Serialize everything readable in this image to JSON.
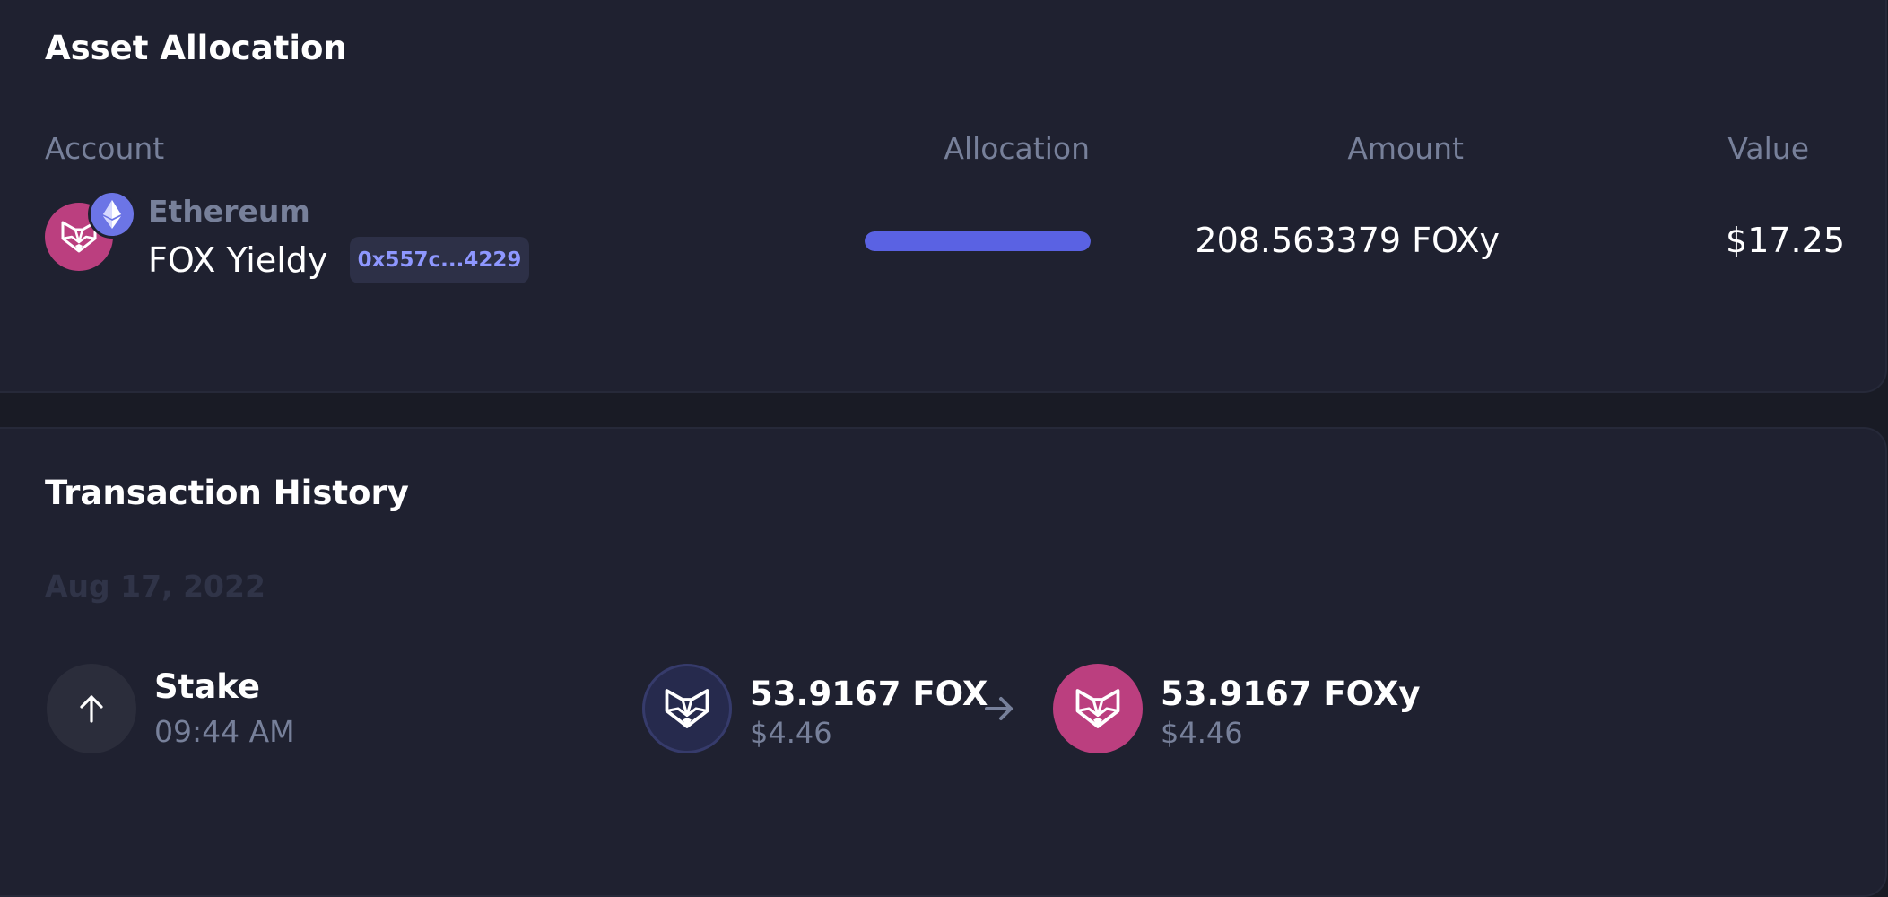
{
  "asset_allocation": {
    "title": "Asset Allocation",
    "columns": {
      "account": "Account",
      "allocation": "Allocation",
      "amount": "Amount",
      "value": "Value"
    },
    "rows": [
      {
        "chain": "Ethereum",
        "asset_name": "FOX Yieldy",
        "address": "0x557c...4229",
        "allocation_fraction": 1.0,
        "amount": "208.563379 FOXy",
        "value": "$17.25",
        "asset_icon": "fox-icon",
        "chain_icon": "ethereum-icon"
      }
    ]
  },
  "transaction_history": {
    "title": "Transaction History",
    "groups": [
      {
        "date": "Aug 17, 2022",
        "transactions": [
          {
            "type": "Stake",
            "time": "09:44 AM",
            "type_icon": "arrow-up-icon",
            "sent": {
              "amount": "53.9167 FOX",
              "fiat": "$4.46",
              "icon": "fox-icon"
            },
            "received": {
              "amount": "53.9167 FOXy",
              "fiat": "$4.46",
              "icon": "foxy-icon"
            },
            "direction_icon": "arrow-right-icon"
          }
        ]
      }
    ]
  },
  "colors": {
    "page_background": "#191b25",
    "card_background": "#1f2130",
    "accent": "#5a62e3",
    "fox_pink": "#bb3f7f",
    "fox_navy": "#262a4d",
    "ethereum": "#6c75e6",
    "muted_text": "#77809a",
    "address_text": "#8e97ff"
  }
}
